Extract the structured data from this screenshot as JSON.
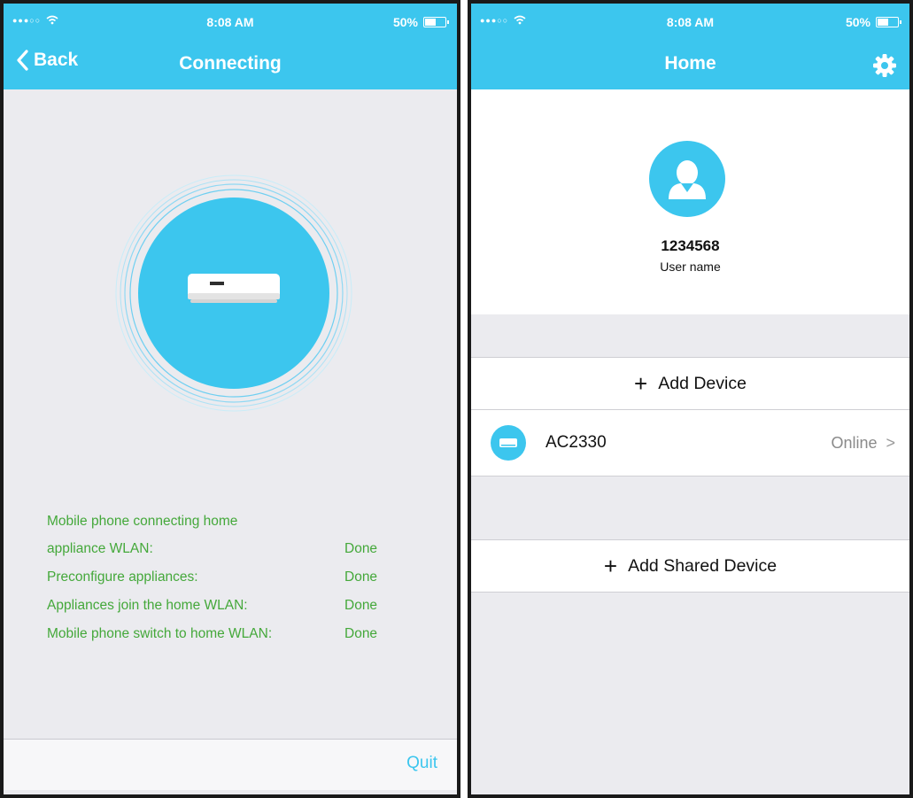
{
  "left_screen": {
    "status_bar": {
      "signal": "●●●○○",
      "time": "8:08 AM",
      "battery": "50%",
      "battery_level": 0.5
    },
    "nav": {
      "back_label": "Back",
      "title": "Connecting"
    },
    "progress": {
      "heading": "Mobile phone connecting home",
      "steps": [
        {
          "label": "appliance WLAN:",
          "status": "Done"
        },
        {
          "label": "Preconfigure appliances:",
          "status": "Done"
        },
        {
          "label": "Appliances join the home WLAN:",
          "status": "Done"
        },
        {
          "label": "Mobile phone switch to home WLAN:",
          "status": "Done"
        }
      ]
    },
    "footer": {
      "quit_label": "Quit"
    }
  },
  "right_screen": {
    "status_bar": {
      "signal": "●●●○○",
      "time": "8:08 AM",
      "battery": "50%",
      "battery_level": 0.5
    },
    "nav": {
      "title": "Home",
      "settings_icon": "gear-icon"
    },
    "profile": {
      "user_id": "1234568",
      "user_label": "User name",
      "avatar_icon": "person-icon"
    },
    "add_device_label": "Add Device",
    "devices": [
      {
        "name": "AC2330",
        "status": "Online",
        "icon": "air-conditioner-icon"
      }
    ],
    "add_shared_label": "Add Shared Device"
  },
  "colors": {
    "accent": "#3cc6ee",
    "done_green": "#44a83a",
    "background": "#ebebef"
  }
}
